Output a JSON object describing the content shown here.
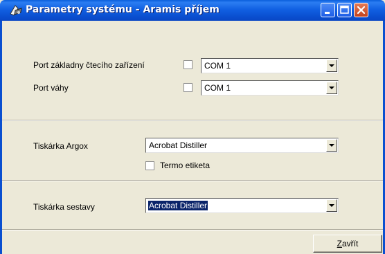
{
  "window": {
    "title": "Parametry systému - Aramis příjem"
  },
  "section_ports": {
    "reader_port_label": "Port základny čtecího zařízení",
    "reader_port_value": "COM 1",
    "scale_port_label": "Port váhy",
    "scale_port_value": "COM 1"
  },
  "section_argox": {
    "printer_label": "Tiskárka Argox",
    "printer_value": "Acrobat Distiller",
    "thermo_label": "Termo etiketa"
  },
  "section_report": {
    "printer_label": "Tiskárka sestavy",
    "printer_value": "Acrobat Distiller"
  },
  "footer": {
    "close_button_underlined": "Z",
    "close_button_rest": "avřít"
  },
  "colors": {
    "titlebar": "#0a5fdc",
    "dialog_bg": "#ece9d8",
    "selection": "#0a246a",
    "close_button": "#c4411c"
  },
  "icons": [
    "app-icon",
    "minimize-icon",
    "maximize-icon",
    "close-icon",
    "dropdown-arrow-icon"
  ]
}
